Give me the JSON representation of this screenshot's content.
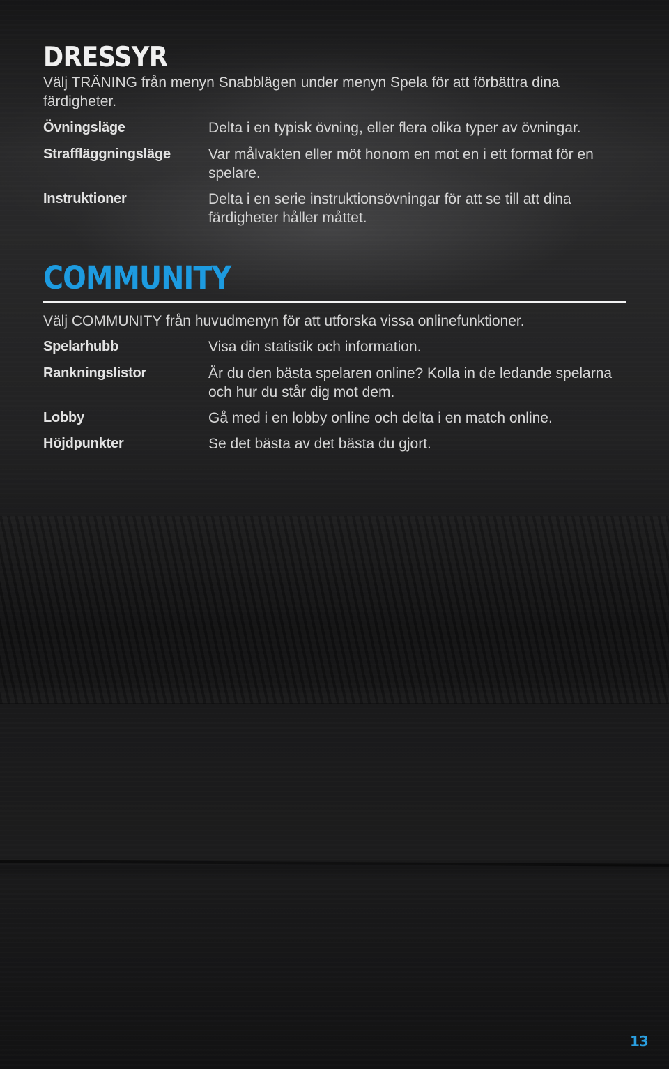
{
  "sections": {
    "dressyr": {
      "heading": "DRESSYR",
      "intro": "Välj TRÄNING från menyn Snabblägen under menyn Spela för att förbättra dina färdigheter.",
      "items": [
        {
          "term": "Övningsläge",
          "description": "Delta i en typisk övning, eller flera olika typer av övningar."
        },
        {
          "term": "Straffläggningsläge",
          "description": "Var målvakten eller möt honom en mot en i ett format för en spelare."
        },
        {
          "term": "Instruktioner",
          "description": "Delta i en serie instruktionsövningar för att se till att dina färdigheter håller måttet."
        }
      ]
    },
    "community": {
      "heading": "COMMUNITY",
      "intro": "Välj COMMUNITY från huvudmenyn för att utforska vissa onlinefunktioner.",
      "items": [
        {
          "term": "Spelarhubb",
          "description": "Visa din statistik och information."
        },
        {
          "term": "Rankningslistor",
          "description": "Är du den bästa spelaren online? Kolla in de ledande spelarna och hur du står dig mot dem."
        },
        {
          "term": "Lobby",
          "description": "Gå med i en lobby online och delta i en match online."
        },
        {
          "term": "Höjdpunkter",
          "description": "Se det bästa av det bästa du gjort."
        }
      ]
    }
  },
  "page_number": "13",
  "colors": {
    "accent": "#1d9be0",
    "heading_white": "#f0f0f0",
    "body_text": "#d6d6d6",
    "background": "#1c1c1d"
  }
}
